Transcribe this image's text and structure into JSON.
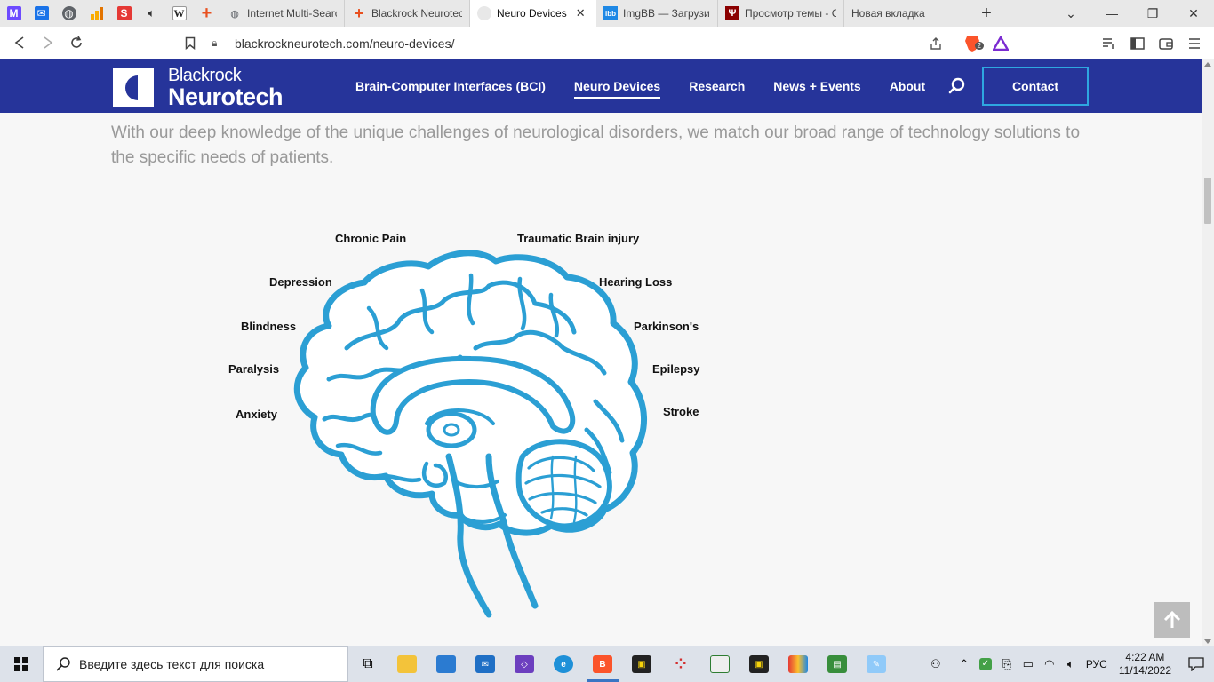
{
  "browser": {
    "pinned_tabs": [
      {
        "icon": "proton-mail-icon",
        "color": "#6d4aff"
      },
      {
        "icon": "outlook-mail-icon",
        "color": "#1a73e8"
      },
      {
        "icon": "globe-icon",
        "color": "#5f6368"
      },
      {
        "icon": "analytics-icon",
        "color": "#f9ab00"
      },
      {
        "icon": "bank-icon",
        "color": "#e53935"
      },
      {
        "icon": "audio-icon",
        "color": "#333333"
      },
      {
        "icon": "wikipedia-icon",
        "color": "#222222",
        "glyph": "W"
      },
      {
        "icon": "plus-cross-icon",
        "color": "#e8501f"
      }
    ],
    "tabs": [
      {
        "title": "Internet Multi-Searc",
        "icon": "globe-icon",
        "active": false
      },
      {
        "title": "Blackrock Neurotec",
        "icon": "plus-cross-icon",
        "active": false
      },
      {
        "title": "Neuro Devices",
        "icon": "blackrock-icon",
        "active": true
      },
      {
        "title": "ImgBB — Загрузить",
        "icon": "imgbb-icon",
        "active": false
      },
      {
        "title": "Просмотр темы - С",
        "icon": "forum-icon",
        "active": false
      },
      {
        "title": "Новая вкладка",
        "icon": "",
        "active": false
      }
    ],
    "url": "blackrockneurotech.com/neuro-devices/",
    "brave_badge": "2"
  },
  "site": {
    "logo_top": "Blackrock",
    "logo_bottom": "Neurotech",
    "nav": [
      {
        "label": "Brain-Computer Interfaces (BCI)",
        "current": false
      },
      {
        "label": "Neuro Devices",
        "current": true
      },
      {
        "label": "Research",
        "current": false
      },
      {
        "label": "News + Events",
        "current": false
      },
      {
        "label": "About",
        "current": false
      }
    ],
    "contact_label": "Contact",
    "brand_color": "#26349a",
    "accent_color": "#2ea7e0"
  },
  "content": {
    "intro": "With our deep knowledge of the unique challenges of neurological disorders, we match our broad range of technology solutions to the specific needs of patients.",
    "brain_labels_left": [
      "Chronic Pain",
      "Depression",
      "Blindness",
      "Paralysis",
      "Anxiety"
    ],
    "brain_labels_right": [
      "Traumatic Brain injury",
      "Hearing Loss",
      "Parkinson's",
      "Epilepsy",
      "Stroke"
    ],
    "illustration_color": "#2b9fd4"
  },
  "taskbar": {
    "search_placeholder": "Введите здесь текст для поиска",
    "language": "РУС",
    "time": "4:22 AM",
    "date": "11/14/2022"
  }
}
